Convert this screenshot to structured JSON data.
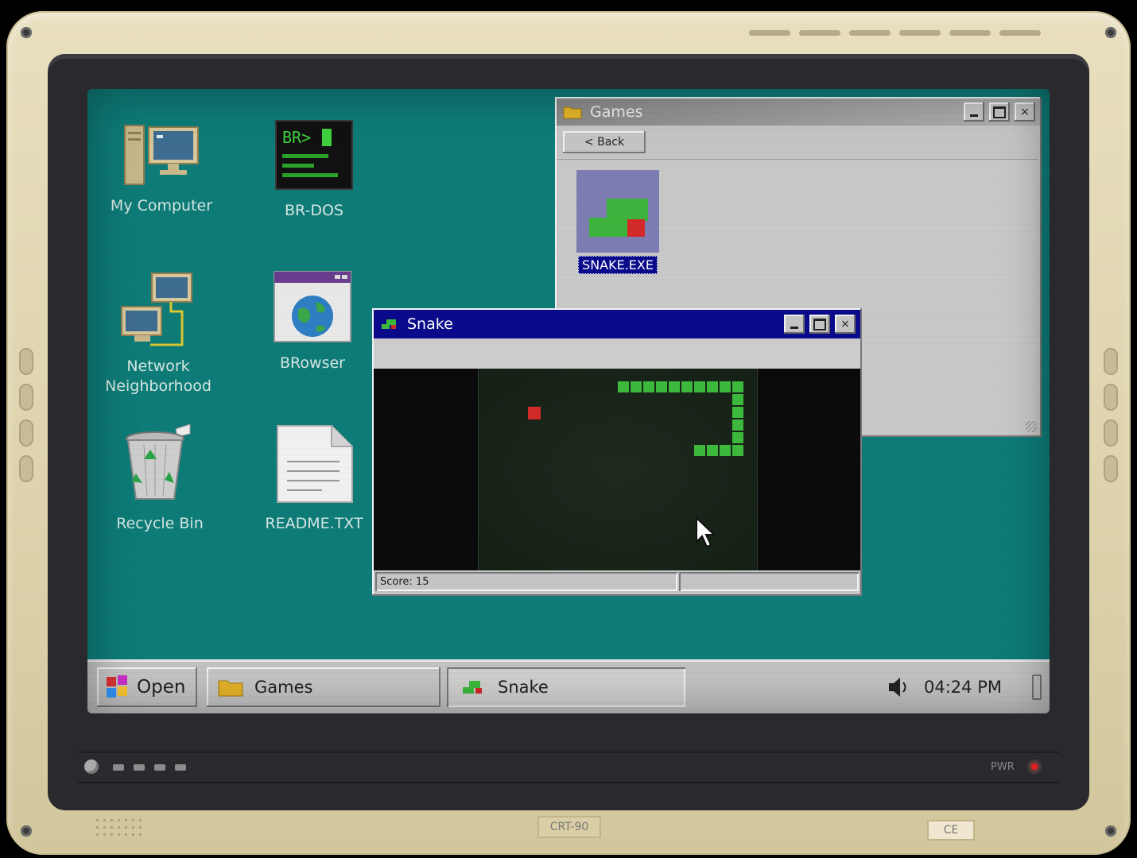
{
  "monitor": {
    "model_label": "CRT-90",
    "ce_label": "CE",
    "power_label": "PWR"
  },
  "desktop": {
    "icons": [
      {
        "label": "My Computer",
        "icon": "computer-icon"
      },
      {
        "label": "BR-DOS",
        "icon": "terminal-icon",
        "prompt": "BR>"
      },
      {
        "label": "Network Neighborhood",
        "icon": "network-icon"
      },
      {
        "label": "BRowser",
        "icon": "browser-icon"
      },
      {
        "label": "Recycle Bin",
        "icon": "recycle-bin-icon"
      },
      {
        "label": "README.TXT",
        "icon": "text-file-icon"
      }
    ]
  },
  "games_window": {
    "title": "Games",
    "back_button": "< Back",
    "files": [
      {
        "label": "SNAKE.EXE",
        "icon": "snake-game-icon",
        "selected": true
      }
    ]
  },
  "snake_window": {
    "title": "Snake",
    "status": "Score: 15",
    "game": {
      "food_color": "#d42a2a",
      "snake_color": "#3dbb3d"
    }
  },
  "taskbar": {
    "start_label": "Open",
    "tasks": [
      {
        "label": "Games",
        "icon": "folder-icon"
      },
      {
        "label": "Snake",
        "icon": "snake-icon"
      }
    ],
    "clock": "04:24 PM"
  },
  "colors": {
    "desktop": "#0e7c78",
    "active_title": "#0a0a8c",
    "inactive_title": "#8a8a8a"
  }
}
